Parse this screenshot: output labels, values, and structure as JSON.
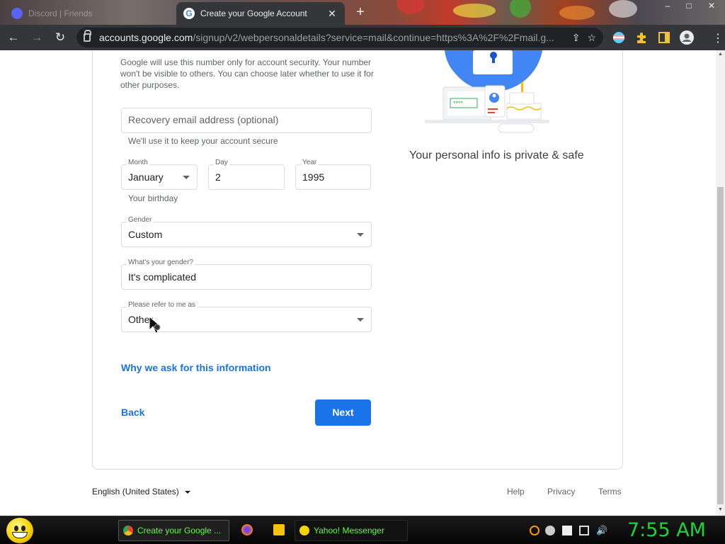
{
  "browser": {
    "tabs": [
      {
        "title": "Discord | Friends",
        "active": false
      },
      {
        "title": "Create your Google Account",
        "active": true
      }
    ],
    "new_tab": "+",
    "url_host": "accounts.google.com",
    "url_path": "/signup/v2/webpersonaldetails?service=mail&continue=https%3A%2F%2Fmail.g...",
    "nav": {
      "back": "←",
      "forward": "→",
      "reload": "↻"
    },
    "window_controls": {
      "minimize": "–",
      "maximize": "□",
      "close": "✕"
    }
  },
  "form": {
    "phone_help": "Google will use this number only for account security. Your number won't be visible to others. You can choose later whether to use it for other purposes.",
    "recovery_email": {
      "placeholder": "Recovery email address (optional)",
      "hint": "We'll use it to keep your account secure"
    },
    "birthday": {
      "month_label": "Month",
      "month_value": "January",
      "day_label": "Day",
      "day_value": "2",
      "year_label": "Year",
      "year_value": "1995",
      "hint": "Your birthday"
    },
    "gender": {
      "label": "Gender",
      "value": "Custom"
    },
    "custom_gender": {
      "label": "What's your gender?",
      "value": "It's complicated"
    },
    "pronoun": {
      "label": "Please refer to me as",
      "value": "Other"
    },
    "why_link": "Why we ask for this information",
    "back_button": "Back",
    "next_button": "Next"
  },
  "sidebar": {
    "privacy_text": "Your personal info is private & safe",
    "password_stars": "****"
  },
  "footer": {
    "language": "English (United States)",
    "links": [
      "Help",
      "Privacy",
      "Terms"
    ]
  },
  "taskbar": {
    "tasks": [
      {
        "label": "Create your Google ...",
        "active": true
      },
      {
        "label": "Yahoo! Messenger",
        "active": false
      }
    ],
    "clock": "7:55 AM"
  },
  "colors": {
    "accent": "#1a73e8",
    "clock": "#19d43b",
    "task_text": "#5dff3c"
  }
}
